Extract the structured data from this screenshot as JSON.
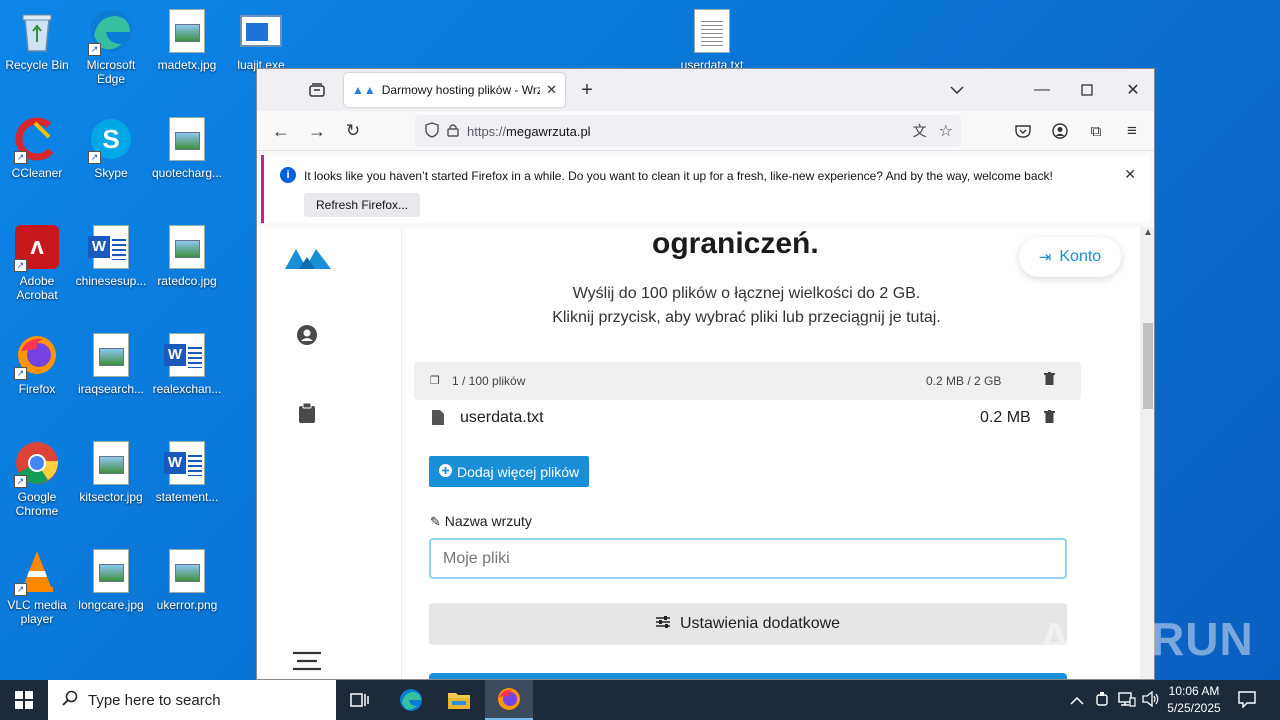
{
  "desktop": {
    "icons": [
      {
        "label": "Recycle Bin"
      },
      {
        "label": "Microsoft Edge"
      },
      {
        "label": "madetx.jpg"
      },
      {
        "label": "luajit.exe"
      },
      {
        "label": "userdata.txt"
      },
      {
        "label": "CCleaner"
      },
      {
        "label": "Skype"
      },
      {
        "label": "quotecharg..."
      },
      {
        "label": "Adobe Acrobat"
      },
      {
        "label": "chinesesup..."
      },
      {
        "label": "ratedco.jpg"
      },
      {
        "label": "Firefox"
      },
      {
        "label": "iraqsearch..."
      },
      {
        "label": "realexchan..."
      },
      {
        "label": "Google Chrome"
      },
      {
        "label": "kitsector.jpg"
      },
      {
        "label": "statement..."
      },
      {
        "label": "VLC media player"
      },
      {
        "label": "longcare.jpg"
      },
      {
        "label": "ukerror.png"
      }
    ]
  },
  "browser": {
    "tab_title": "Darmowy hosting plików - Wrzuta",
    "url_proto": "https://",
    "url_host": "megawrzuta.pl",
    "infobar": {
      "message": "It looks like you haven’t started Firefox in a while. Do you want to clean it up for a fresh, like-new experience? And by the way, welcome back!",
      "button": "Refresh Firefox..."
    }
  },
  "page": {
    "heading": "ograniczeń.",
    "konto": "Konto",
    "sub1": "Wyślij do 100 plików o łącznej wielkości do 2 GB.",
    "sub2": "Kliknij przycisk, aby wybrać pliki lub przeciągnij je tutaj.",
    "files_count": "1 / 100 plików",
    "files_size": "0.2 MB / 2 GB",
    "file_name": "userdata.txt",
    "file_size": "0.2 MB",
    "add_more": "Dodaj więcej plików",
    "name_label": "Nazwa wrzuty",
    "name_placeholder": "Moje pliki",
    "settings": "Ustawienia dodatkowe"
  },
  "taskbar": {
    "search_placeholder": "Type here to search",
    "time": "10:06 AM",
    "date": "5/25/2025"
  },
  "watermark": "ANY RUN"
}
